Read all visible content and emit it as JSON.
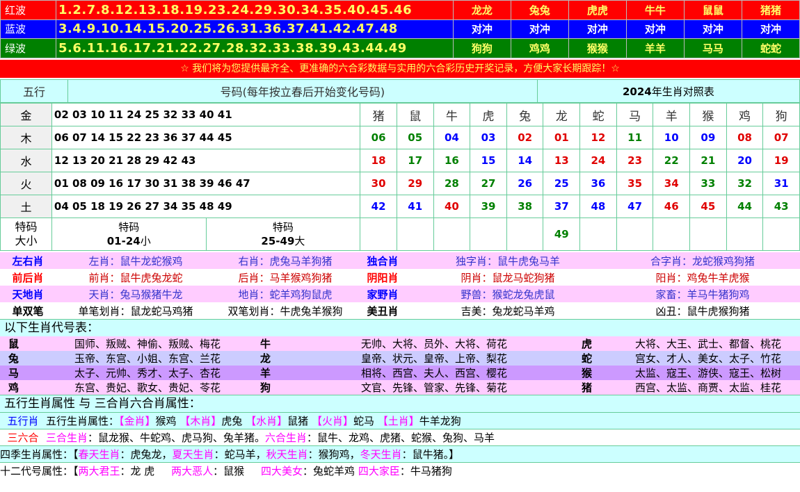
{
  "waves": [
    {
      "name": "红波",
      "numbers": "1.2.7.8.12.13.18.19.23.24.29.30.34.35.40.45.46",
      "zodiacs": [
        "龙龙",
        "兔兔",
        "虎虎",
        "牛牛",
        "鼠鼠",
        "猪猪"
      ]
    },
    {
      "name": "蓝波",
      "numbers": "3.4.9.10.14.15.20.25.26.31.36.37.41.42.47.48",
      "zodiacs": [
        "对冲",
        "对冲",
        "对冲",
        "对冲",
        "对冲",
        "对冲"
      ]
    },
    {
      "name": "绿波",
      "numbers": "5.6.11.16.17.21.22.27.28.32.33.38.39.43.44.49",
      "zodiacs": [
        "狗狗",
        "鸡鸡",
        "猴猴",
        "羊羊",
        "马马",
        "蛇蛇"
      ]
    }
  ],
  "banner": "☆ 我们将为您提供最齐全、更准确的六合彩数据与实用的六合彩历史开奖记录，方便大家长期跟踪！☆",
  "wuxing": {
    "header_label": "五行",
    "header_numbers": "号码(每年按立春后开始变化号码)",
    "header_year": "2024",
    "header_year_suffix": "年生肖对照表",
    "zodiac_header": [
      "猪",
      "鼠",
      "牛",
      "虎",
      "兔",
      "龙",
      "蛇",
      "马",
      "羊",
      "猴",
      "鸡",
      "狗"
    ],
    "rows": [
      {
        "label": "金",
        "numbers": "02 03 10 11 24 25 32 33 40 41",
        "cells": [
          "",
          "",
          "",
          "",
          "",
          "",
          "",
          "",
          "",
          "",
          "",
          ""
        ]
      },
      {
        "label": "木",
        "numbers": "06 07 14 15 22 23 36 37 44 45",
        "cells": [
          "06",
          "05",
          "04",
          "03",
          "02",
          "01",
          "12",
          "11",
          "10",
          "09",
          "08",
          "07"
        ]
      },
      {
        "label": "水",
        "numbers": "12 13 20 21 28 29 42 43",
        "cells": [
          "18",
          "17",
          "16",
          "15",
          "14",
          "13",
          "24",
          "23",
          "22",
          "21",
          "20",
          "19"
        ]
      },
      {
        "label": "火",
        "numbers": "01 08 09 16 17 30 31 38 39 46 47",
        "cells": [
          "30",
          "29",
          "28",
          "27",
          "26",
          "25",
          "36",
          "35",
          "34",
          "33",
          "32",
          "31"
        ]
      },
      {
        "label": "土",
        "numbers": "04 05 18 19 26 27 34 35 48 49",
        "cells": [
          "42",
          "41",
          "40",
          "39",
          "38",
          "37",
          "48",
          "47",
          "46",
          "45",
          "44",
          "43"
        ]
      }
    ],
    "special": {
      "label_top": "特码",
      "label_bottom": "大小",
      "small_title": "特码",
      "small_range": "01-24",
      "small_word": "小",
      "big_title": "特码",
      "big_range": "25-49",
      "big_word": "大",
      "extra": "49"
    }
  },
  "properties": [
    {
      "k1": "左右肖",
      "a": "左肖：鼠牛龙蛇猴鸡",
      "b": "右肖：虎兔马羊狗猪",
      "k2": "独合肖",
      "c": "独字肖：鼠牛虎兔马羊",
      "d": "合字肖：龙蛇猴鸡狗猪"
    },
    {
      "k1": "前后肖",
      "a": "前肖：鼠牛虎兔龙蛇",
      "b": "后肖：马羊猴鸡狗猪",
      "k2": "阴阳肖",
      "c": "阴肖：鼠龙马蛇狗猪",
      "d": "阳肖：鸡兔牛羊虎猴"
    },
    {
      "k1": "天地肖",
      "a": "天肖：兔马猴猪牛龙",
      "b": "地肖：蛇羊鸡狗鼠虎",
      "k2": "家野肖",
      "c": "野兽：猴蛇龙兔虎鼠",
      "d": "家畜：羊马牛猪狗鸡"
    },
    {
      "k1": "单双笔",
      "a": "单笔划肖：鼠龙蛇马鸡猪",
      "b": "双笔划肖：牛虎兔羊猴狗",
      "k2": "美丑肖",
      "c": "吉美：兔龙蛇马羊鸡",
      "d": "凶丑：鼠牛虎猴狗猪"
    }
  ],
  "code_title": "以下生肖代号表：",
  "codes": [
    [
      {
        "z": "鼠",
        "v": "国师、叛贼、神偷、叛贼、梅花"
      },
      {
        "z": "牛",
        "v": "无帅、大将、员外、大将、荷花"
      },
      {
        "z": "虎",
        "v": "大将、大王、武士、都督、桃花"
      }
    ],
    [
      {
        "z": "兔",
        "v": "玉帝、东宫、小姐、东宫、兰花"
      },
      {
        "z": "龙",
        "v": "皇帝、状元、皇帝、上帝、梨花"
      },
      {
        "z": "蛇",
        "v": "宫女、才人、美女、太子、竹花"
      }
    ],
    [
      {
        "z": "马",
        "v": "太子、元帅、秀才、太子、杏花"
      },
      {
        "z": "羊",
        "v": "相将、西宫、夫人、西宫、樱花"
      },
      {
        "z": "猴",
        "v": "太监、寇王、游侠、寇王、松树"
      }
    ],
    [
      {
        "z": "鸡",
        "v": "东宫、贵妃、歌女、贵妃、苓花"
      },
      {
        "z": "狗",
        "v": "文官、先锋、管家、先锋、菊花"
      },
      {
        "z": "猪",
        "v": "西宫、太监、商贾、太监、桂花"
      }
    ]
  ],
  "attr_title": "五行生肖属性 与 三合肖六合肖属性：",
  "attr1": {
    "k": "五行肖",
    "prefix": "五行生肖属性：",
    "gold": "【金肖】",
    "gold_v": "猴鸡",
    "wood": "【木肖】",
    "wood_v": "虎兔",
    "water": "【水肖】",
    "water_v": "鼠猪",
    "fire": "【火肖】",
    "fire_v": "蛇马",
    "earth": "【土肖】",
    "earth_v": "牛羊龙狗"
  },
  "attr2": {
    "k": "三六合",
    "sanhe": "三合生肖",
    "sanhe_v": "：鼠龙猴、牛蛇鸡、虎马狗、兔羊猪。",
    "liuhe": "六合生肖",
    "liuhe_v": "：鼠牛、龙鸡、虎猪、蛇猴、兔狗、马羊"
  },
  "seasons": {
    "prefix": "四季生肖属性：【",
    "spring": "春天生肖",
    "spring_v": "：虎兔龙，",
    "summer": "夏天生肖",
    "summer_v": "：蛇马羊，",
    "autumn": "秋天生肖",
    "autumn_v": "：猴狗鸡，",
    "winter": "冬天生肖",
    "winter_v": "：鼠牛猪。】"
  },
  "twelve": {
    "prefix": "十二代号属性：【",
    "jun": "两大君王",
    "jun_v": "：龙 虎",
    "e": "两大恶人",
    "e_v": "：鼠猴",
    "mei": "四大美女",
    "mei_v": "：兔蛇羊鸡",
    "jia": "四大家臣",
    "jia_v": "：牛马猪狗"
  }
}
